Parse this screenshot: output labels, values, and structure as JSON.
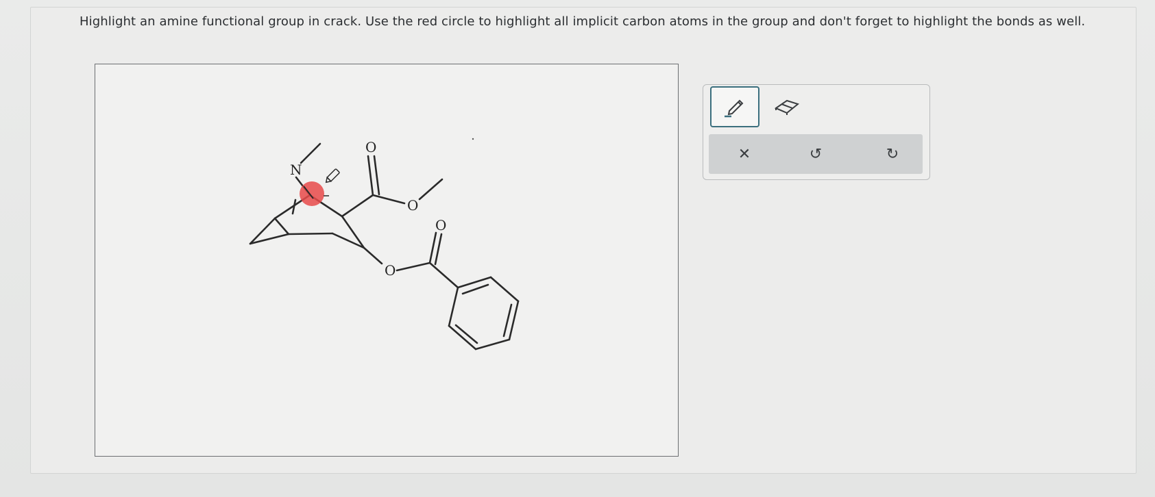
{
  "question": {
    "text": "Highlight an amine functional group in crack. Use the red circle to highlight all implicit carbon atoms in the group and don't forget to highlight the bonds as well."
  },
  "molecule": {
    "atom_labels": {
      "nitrogen": "N",
      "ester_carbonyl_oxygen": "O",
      "ester_ether_oxygen": "O",
      "benzoate_carbonyl_oxygen": "O",
      "benzoate_ether_oxygen": "O"
    },
    "highlight_color": "#e84a4a"
  },
  "toolbox": {
    "tools": [
      {
        "name": "pencil-tool",
        "icon": "pencil-icon",
        "active": true
      },
      {
        "name": "eraser-tool",
        "icon": "eraser-icon",
        "active": false
      }
    ],
    "actions": [
      {
        "name": "clear",
        "glyph": "✕",
        "icon": "close-icon"
      },
      {
        "name": "undo",
        "glyph": "↺",
        "icon": "undo-icon"
      },
      {
        "name": "redo",
        "glyph": "↻",
        "icon": "redo-icon"
      }
    ],
    "accent_color": "#3b6f7e"
  }
}
